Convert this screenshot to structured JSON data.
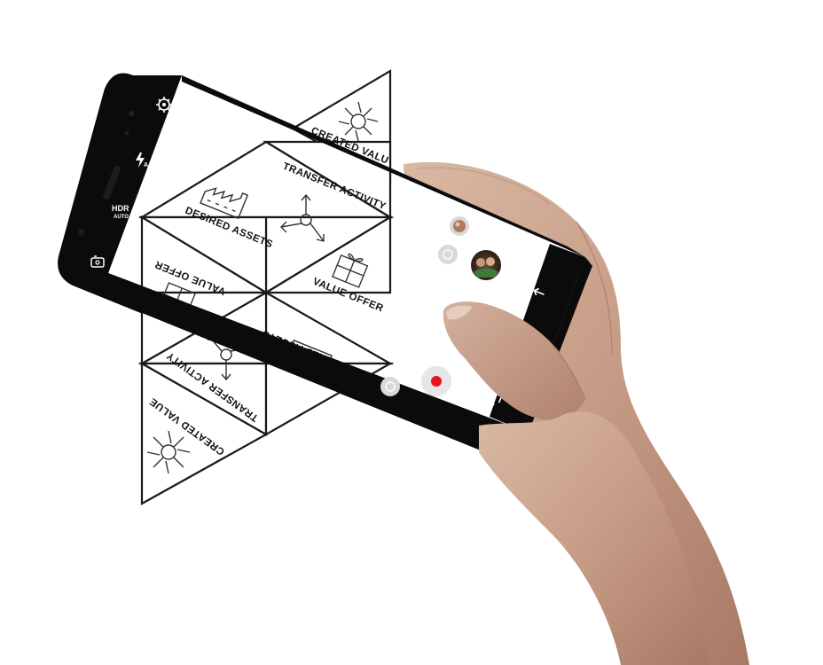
{
  "camera": {
    "hdr_label": "HDR",
    "hdr_mode": "AUTO",
    "left_rail_icons": [
      "settings-icon",
      "flash-auto-icon",
      "hdr-icon",
      "switch-camera-icon"
    ],
    "right_rail_icons": [
      "back-icon",
      "recent-apps-icon"
    ],
    "record_button_color": "#e8151b"
  },
  "diagram": {
    "created_value_label": "CREATED VALUE",
    "transfer_activity_label": "TRANSFER ACTIVITY",
    "desired_assets_label": "DESIRED ASSETS",
    "value_offer_label": "VALUE OFFER",
    "created_value_label_short": "CREATED VALU"
  }
}
